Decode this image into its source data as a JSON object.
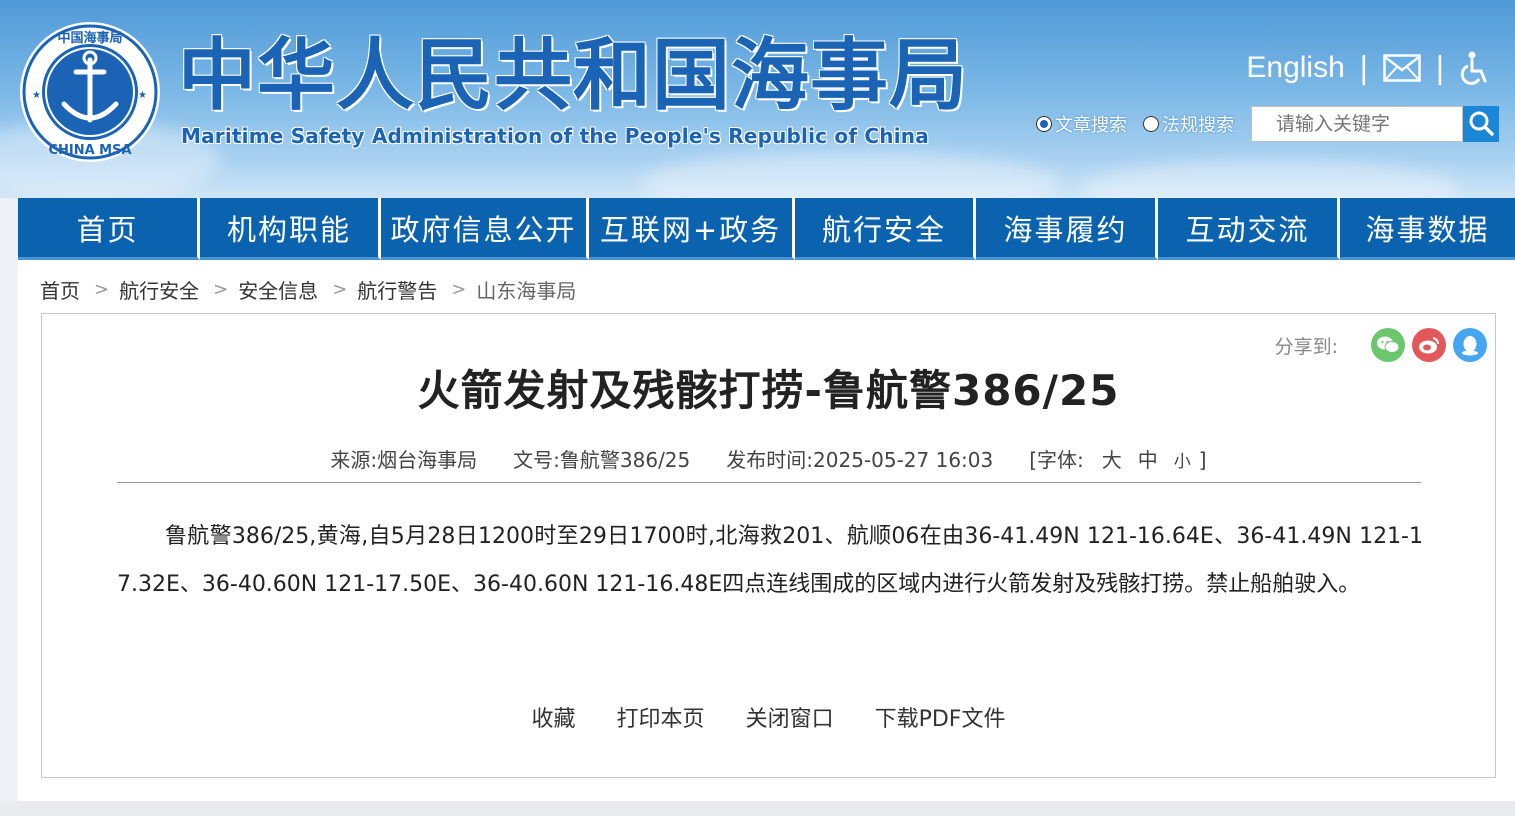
{
  "header": {
    "title_cn": "中华人民共和国海事局",
    "title_en": "Maritime Safety Administration of the People's Republic of China",
    "logo_text_top": "中国海事局",
    "logo_text_bottom": "CHINA MSA",
    "english_link": "English",
    "mail_icon": "mail-icon",
    "accessibility_icon": "accessibility-icon"
  },
  "search": {
    "options": [
      "文章搜索",
      "法规搜索"
    ],
    "selected": "文章搜索",
    "placeholder": "请输入关键字",
    "button_icon": "search-icon"
  },
  "nav": {
    "items": [
      "首页",
      "机构职能",
      "政府信息公开",
      "互联网+政务",
      "航行安全",
      "海事履约",
      "互动交流",
      "海事数据"
    ]
  },
  "breadcrumb": [
    "首页",
    "航行安全",
    "安全信息",
    "航行警告",
    "山东海事局"
  ],
  "share": {
    "label": "分享到:",
    "icons": [
      "wechat-icon",
      "weibo-icon",
      "qq-icon"
    ],
    "colors": [
      "#6cc66c",
      "#e2585a",
      "#46a6f2"
    ]
  },
  "article": {
    "title": "火箭发射及残骸打捞-鲁航警386/25",
    "source_label": "来源:",
    "source": "烟台海事局",
    "doc_label": "文号:",
    "doc_no": "鲁航警386/25",
    "time_label": "发布时间:",
    "time": "2025-05-27 16:03",
    "font_label": "[字体:",
    "font_sizes": [
      "大",
      "中",
      "小"
    ],
    "font_close": "]",
    "body": "鲁航警386/25,黄海,自5月28日1200时至29日1700时,北海救201、航顺06在由36-41.49N 121-16.64E、36-41.49N 121-17.32E、36-40.60N 121-17.50E、36-40.60N 121-16.48E四点连线围成的区域内进行火箭发射及残骸打捞。禁止船舶驶入。"
  },
  "actions": [
    "收藏",
    "打印本页",
    "关闭窗口",
    "下载PDF文件"
  ],
  "colors": {
    "nav_bg": "#0b63b0",
    "title_blue": "#1b63b5"
  }
}
